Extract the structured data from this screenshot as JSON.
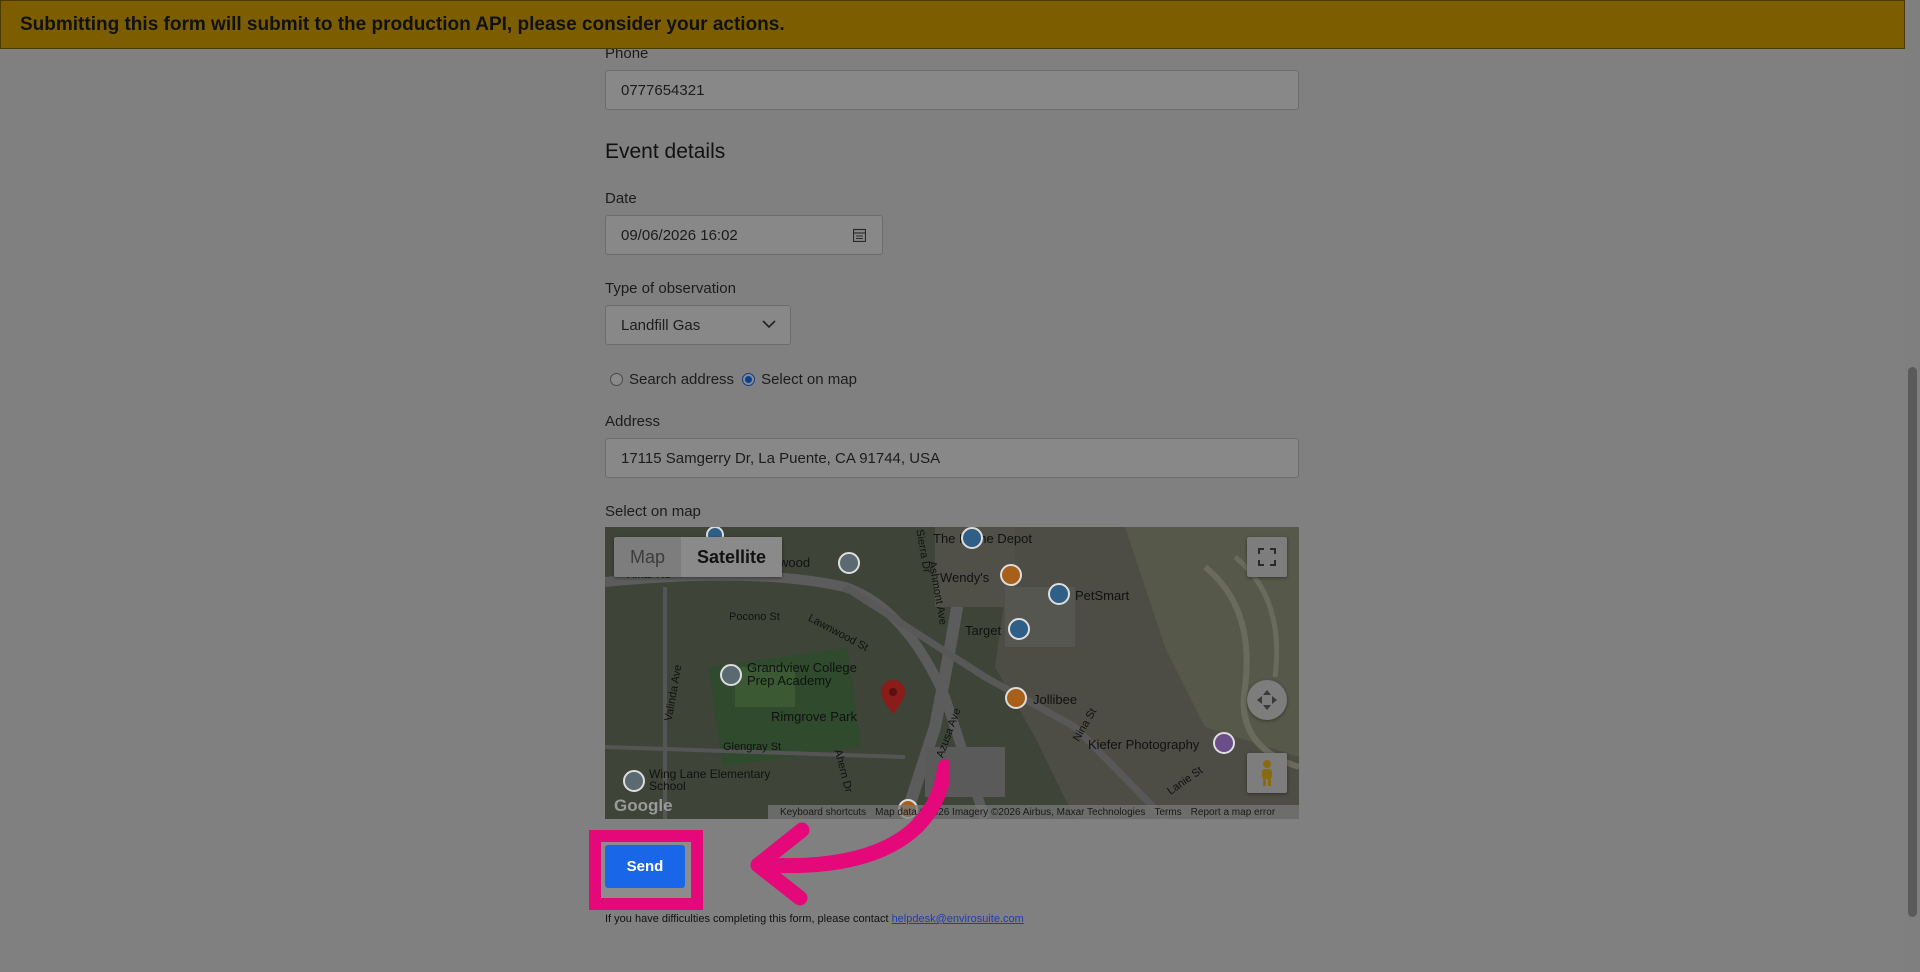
{
  "banner": {
    "text": "Submitting this form will submit to the production API, please consider your actions."
  },
  "contact": {
    "phone_label": "Phone",
    "phone_value": "0777654321"
  },
  "event": {
    "heading": "Event details",
    "date_label": "Date",
    "date_value": "09/06/2026 16:02",
    "type_label": "Type of observation",
    "type_value": "Landfill Gas",
    "location_options": [
      "Search address",
      "Select on map"
    ],
    "location_selected": "Select on map",
    "address_label": "Address",
    "address_value": "17115 Samgerry Dr, La Puente, CA 91744, USA",
    "map_label": "Select on map"
  },
  "map": {
    "type_options": [
      "Map",
      "Satellite"
    ],
    "type_selected": "Satellite",
    "places": [
      "The Home Depot",
      "Wendy's",
      "PetSmart",
      "Target",
      "Jollibee",
      "Kiefer Photography",
      "Grandview College Prep Academy",
      "Rimgrove Park",
      "Wing Lane Elementary School"
    ],
    "streets": [
      "Amar Rd",
      "Pocono St",
      "Lawnwood St",
      "Valinda Ave",
      "Glengray St",
      "Azusa Ave",
      "Nina St",
      "Lanie St",
      "Ahern Dr",
      "Ashmont Ave",
      "Sierra Dr",
      "Ridgewood"
    ],
    "logo": "Google",
    "footer": [
      "Keyboard shortcuts",
      "Map data ©2026 Imagery ©2026 Airbus, Maxar Technologies",
      "Terms",
      "Report a map error"
    ]
  },
  "actions": {
    "send_label": "Send"
  },
  "help": {
    "text": "If you have difficulties completing this form, please contact ",
    "email": "helpdesk@envirosuite.com"
  },
  "colors": {
    "banner": "#7c5e00",
    "send_button": "#1a66e8",
    "highlight": "#e5087a",
    "overlay": "#808080"
  },
  "icons": [
    "calendar-icon",
    "chevron-down-icon",
    "fullscreen-icon",
    "camera-control-icon",
    "pegman-icon",
    "map-pin-icon",
    "annotation-arrow"
  ]
}
